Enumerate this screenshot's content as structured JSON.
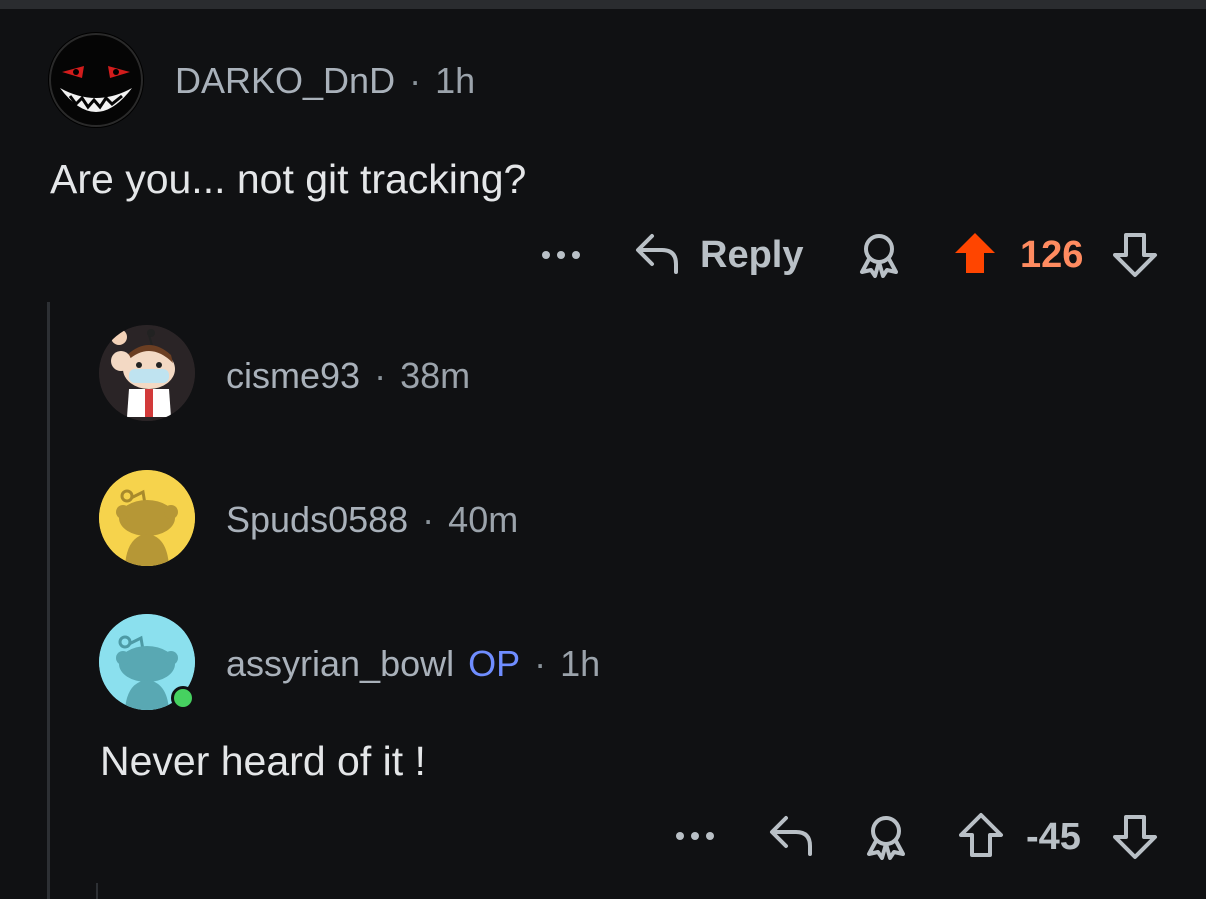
{
  "comments": [
    {
      "username": "DARKO_DnD",
      "time": "1h",
      "text": "Are you... not git tracking?",
      "reply_label": "Reply",
      "score": "126",
      "upvoted": true
    },
    {
      "username": "cisme93",
      "time": "38m"
    },
    {
      "username": "Spuds0588",
      "time": "40m"
    },
    {
      "username": "assyrian_bowl",
      "op_badge": "OP",
      "time": "1h",
      "text": "Never heard of it !",
      "score": "-45",
      "online": true
    }
  ],
  "separator": "·",
  "colors": {
    "background": "#101113",
    "upvote": "#ff4500",
    "score_upvoted": "#ff8b60",
    "op": "#6f8dff",
    "online": "#46d160"
  },
  "icons": [
    "more-icon",
    "reply-icon",
    "award-icon",
    "upvote-icon",
    "downvote-icon"
  ]
}
